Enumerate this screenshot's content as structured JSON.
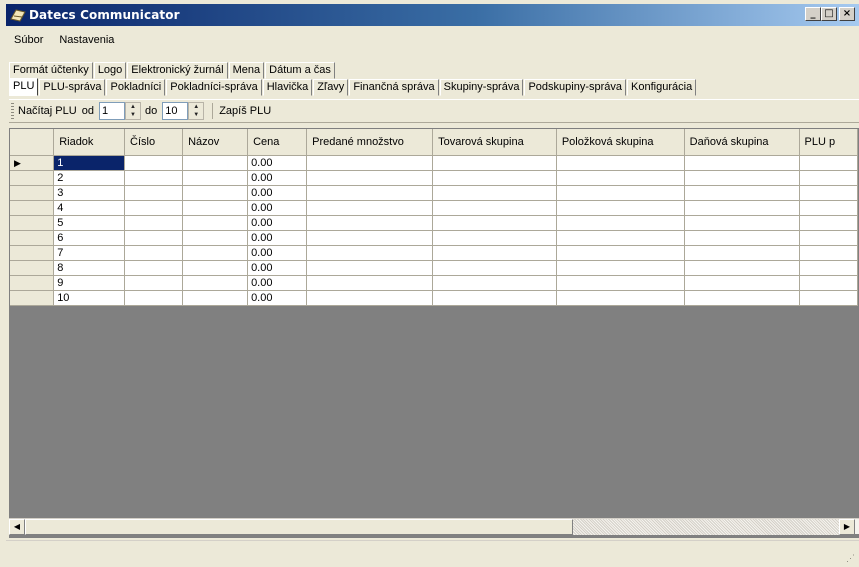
{
  "window": {
    "title": "Datecs Communicator",
    "icon": "datecs-app-icon",
    "buttons": [
      "minimize",
      "maximize",
      "close"
    ]
  },
  "menu": [
    "Súbor",
    "Nastavenia"
  ],
  "tabs_row1": [
    "Formát účtenky",
    "Logo",
    "Elektronický žurnál",
    "Mena",
    "Dátum a čas"
  ],
  "tabs_row2": [
    "PLU",
    "PLU-správa",
    "Pokladníci",
    "Pokladníci-správa",
    "Hlavička",
    "Zľavy",
    "Finančná správa",
    "Skupiny-správa",
    "Podskupiny-správa",
    "Konfigurácia"
  ],
  "active_tab": "PLU",
  "toolbar": {
    "load_label": "Načítaj PLU",
    "from_label": "od",
    "from_value": "1",
    "to_label": "do",
    "to_value": "10",
    "write_label": "Zapíš PLU"
  },
  "grid": {
    "columns": [
      "Riadok",
      "Číslo",
      "Názov",
      "Cena",
      "Predané množstvo",
      "Tovarová skupina",
      "Položková skupina",
      "Daňová skupina",
      "PLU p"
    ],
    "rows": [
      [
        "1",
        "",
        "",
        "0.00",
        "",
        "",
        "",
        "",
        ""
      ],
      [
        "2",
        "",
        "",
        "0.00",
        "",
        "",
        "",
        "",
        ""
      ],
      [
        "3",
        "",
        "",
        "0.00",
        "",
        "",
        "",
        "",
        ""
      ],
      [
        "4",
        "",
        "",
        "0.00",
        "",
        "",
        "",
        "",
        ""
      ],
      [
        "5",
        "",
        "",
        "0.00",
        "",
        "",
        "",
        "",
        ""
      ],
      [
        "6",
        "",
        "",
        "0.00",
        "",
        "",
        "",
        "",
        ""
      ],
      [
        "7",
        "",
        "",
        "0.00",
        "",
        "",
        "",
        "",
        ""
      ],
      [
        "8",
        "",
        "",
        "0.00",
        "",
        "",
        "",
        "",
        ""
      ],
      [
        "9",
        "",
        "",
        "0.00",
        "",
        "",
        "",
        "",
        ""
      ],
      [
        "10",
        "",
        "",
        "0.00",
        "",
        "",
        "",
        "",
        ""
      ]
    ],
    "selected_row": 0
  },
  "colors": {
    "title_start": "#0a246a",
    "title_end": "#a6caf0",
    "selection": "#0a246a",
    "grid_bg": "#808080"
  }
}
